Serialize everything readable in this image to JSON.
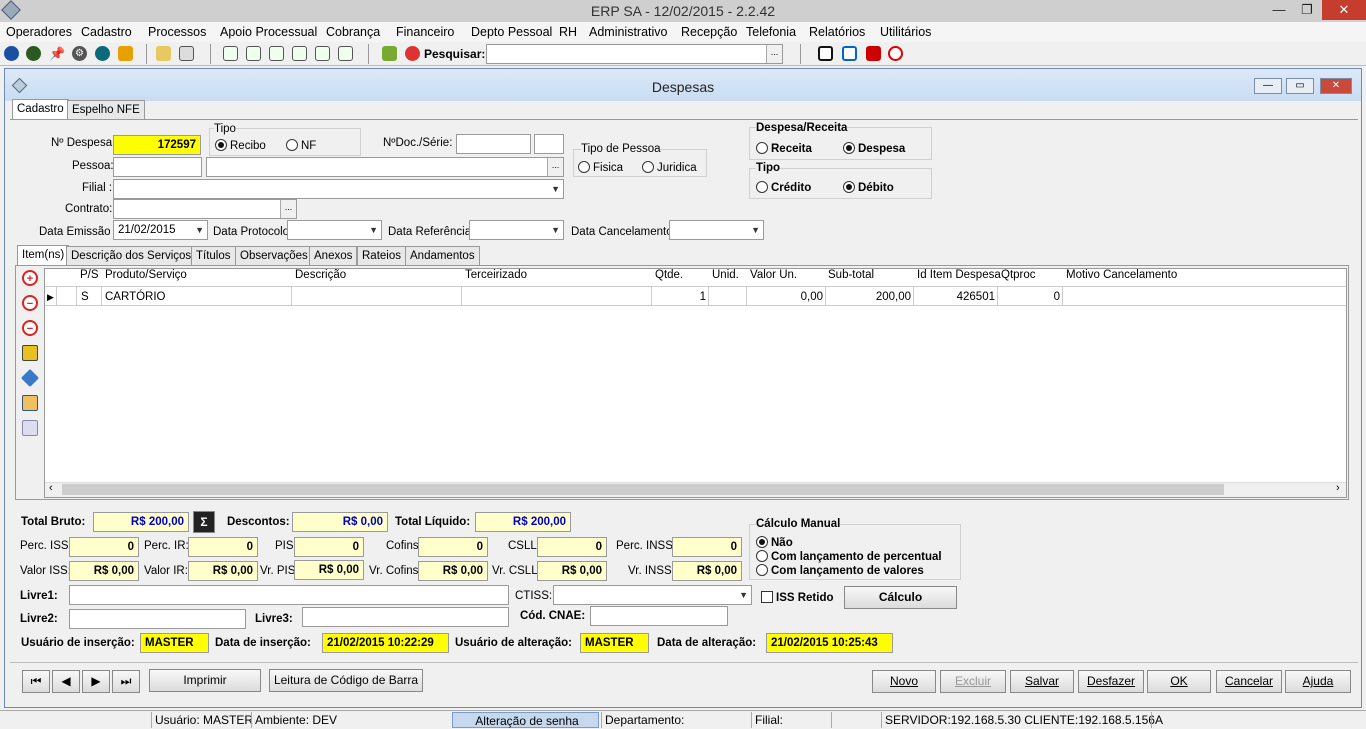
{
  "app": {
    "title": "ERP  SA - 12/02/2015 - 2.2.42"
  },
  "menu": [
    "Operadores",
    "Cadastro",
    "Processos",
    "Apoio Processual",
    "Cobrança",
    "Financeiro",
    "Depto Pessoal",
    "RH",
    "Administrativo",
    "Recepção",
    "Telefonia",
    "Relatórios",
    "Utilitários"
  ],
  "toolbar": {
    "search_label": "Pesquisar:",
    "search_value": ""
  },
  "window": {
    "title": "Despesas"
  },
  "tabs": [
    "Cadastro",
    "Espelho NFE"
  ],
  "form": {
    "num_despesa_label": "Nº Despesa:",
    "num_despesa": "172597",
    "tipo_label": "Tipo",
    "tipo_recibo": "Recibo",
    "tipo_nf": "NF",
    "ndoc_label": "NºDoc./Série:",
    "tipo_pessoa_label": "Tipo de Pessoa",
    "fisica": "Fisica",
    "juridica": "Juridica",
    "despesa_receita_label": "Despesa/Receita",
    "receita": "Receita",
    "despesa": "Despesa",
    "tipo2_label": "Tipo",
    "credito": "Crédito",
    "debito": "Débito",
    "pessoa_label": "Pessoa:",
    "filial_label": "Filial :",
    "contrato_label": "Contrato:",
    "data_emissao_label": "Data Emissão :",
    "data_emissao": "21/02/2015",
    "data_protocolo_label": "Data Protocolo:",
    "data_referencia_label": "Data Referência:",
    "data_cancelamento_label": "Data Cancelamento:"
  },
  "subtabs": [
    "Item(ns)",
    "Descrição dos Serviços",
    "Títulos",
    "Observações",
    "Anexos",
    "Rateios",
    "Andamentos"
  ],
  "grid": {
    "columns": [
      "P/S",
      "Produto/Serviço",
      "Descrição",
      "Terceirizado",
      "Qtde.",
      "Unid.",
      "Valor Un.",
      "Sub-total",
      "Id Item Despesa",
      "Qtproc",
      "Motivo Cancelamento"
    ],
    "rows": [
      [
        "S",
        "CARTÓRIO",
        "",
        "",
        "1",
        "",
        "0,00",
        "200,00",
        "426501",
        "0",
        ""
      ]
    ]
  },
  "totals": {
    "total_bruto_label": "Total Bruto:",
    "total_bruto": "R$ 200,00",
    "descontos_label": "Descontos:",
    "descontos": "R$ 0,00",
    "total_liquido_label": "Total Líquido:",
    "total_liquido": "R$ 200,00",
    "perc_iss_label": "Perc. ISS:",
    "perc_iss": "0",
    "perc_ir_label": "Perc. IR:",
    "perc_ir": "0",
    "pis_label": "PIS",
    "pis": "0",
    "cofins_label": "Cofins:",
    "cofins": "0",
    "csll_label": "CSLL:",
    "csll": "0",
    "perc_inss_label": "Perc. INSS:",
    "perc_inss": "0",
    "valor_iss_label": "Valor ISS:",
    "valor_iss": "R$ 0,00",
    "valor_ir_label": "Valor IR:",
    "valor_ir": "R$ 0,00",
    "vr_pis_label": "Vr. PIS",
    "vr_pis": "R$ 0,00",
    "vr_cofins_label": "Vr. Cofins:",
    "vr_cofins": "R$ 0,00",
    "vr_csll_label": "Vr. CSLL:",
    "vr_csll": "R$ 0,00",
    "vr_inss_label": "Vr. INSS:",
    "vr_inss": "R$ 0,00"
  },
  "calculo": {
    "label": "Cálculo Manual",
    "nao": "Não",
    "com_percentual": "Com lançamento de percentual",
    "com_valores": "Com lançamento de valores"
  },
  "extra": {
    "livre1_label": "Livre1:",
    "livre2_label": "Livre2:",
    "livre3_label": "Livre3:",
    "ctiss_label": "CTISS:",
    "iss_retido_label": "ISS Retido",
    "cod_cnae_label": "Cód. CNAE:",
    "calculo_button": "Cálculo"
  },
  "audit": {
    "usuario_insercao_label": "Usuário de inserção:",
    "usuario_insercao": "MASTER",
    "data_insercao_label": "Data de inserção:",
    "data_insercao": "21/02/2015 10:22:29",
    "usuario_alteracao_label": "Usuário de alteração:",
    "usuario_alteracao": "MASTER",
    "data_alteracao_label": "Data de alteração:",
    "data_alteracao": "21/02/2015 10:25:43"
  },
  "buttons": {
    "imprimir": "Imprimir",
    "leitura": "Leitura de Código de Barra",
    "novo": "Novo",
    "excluir": "Excluir",
    "salvar": "Salvar",
    "desfazer": "Desfazer",
    "ok": "OK",
    "cancelar": "Cancelar",
    "ajuda": "Ajuda"
  },
  "status": {
    "usuario": "Usuário: MASTER",
    "ambiente": "Ambiente: DEV",
    "alteracao_senha": "Alteração de senha",
    "departamento": "Departamento:",
    "filial": "Filial:",
    "servidor": "SERVIDOR:192.168.5.30 CLIENTE:192.168.5.156",
    "flag": "A"
  }
}
